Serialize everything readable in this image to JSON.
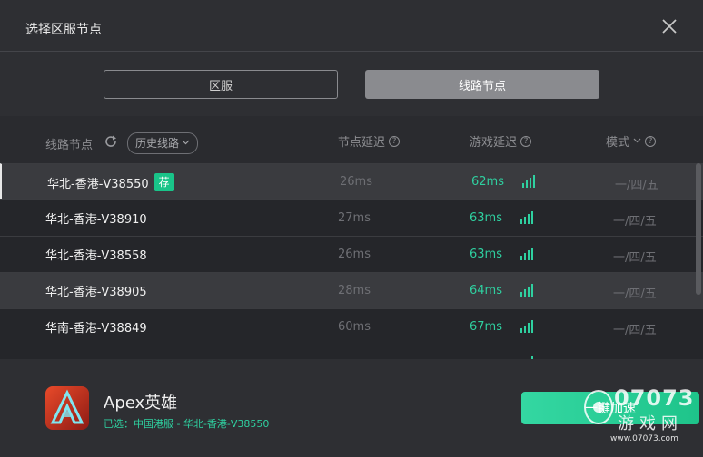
{
  "dialog": {
    "title": "选择区服节点",
    "close_icon": "close-icon"
  },
  "tabs": [
    {
      "label": "区服",
      "active": false
    },
    {
      "label": "线路节点",
      "active": true
    }
  ],
  "table": {
    "headers": {
      "route": "线路节点",
      "history": "历史线路",
      "node_ping": "节点延迟",
      "game_ping": "游戏延迟",
      "mode": "模式"
    },
    "rows": [
      {
        "name": "华北-香港-V38550",
        "badge": "荐",
        "node_ping": "26ms",
        "game_ping": "62ms",
        "mode": "一/四/五",
        "style": "alt",
        "selected": true
      },
      {
        "name": "华北-香港-V38910",
        "badge": "",
        "node_ping": "27ms",
        "game_ping": "63ms",
        "mode": "一/四/五",
        "style": "dark",
        "selected": false
      },
      {
        "name": "华北-香港-V38558",
        "badge": "",
        "node_ping": "26ms",
        "game_ping": "63ms",
        "mode": "一/四/五",
        "style": "dark",
        "selected": false
      },
      {
        "name": "华北-香港-V38905",
        "badge": "",
        "node_ping": "28ms",
        "game_ping": "64ms",
        "mode": "一/四/五",
        "style": "alt",
        "selected": false
      },
      {
        "name": "华南-香港-V38849",
        "badge": "",
        "node_ping": "60ms",
        "game_ping": "67ms",
        "mode": "一/四/五",
        "style": "dark",
        "selected": false
      },
      {
        "name": "",
        "badge": "",
        "node_ping": "",
        "game_ping": "",
        "mode": "",
        "style": "dark",
        "selected": false
      }
    ],
    "signal_color": "#2fd0a0"
  },
  "footer": {
    "game_name": "Apex英雄",
    "selected_info": "已选：中国港服 - 华北-香港-V38550",
    "accelerate_label": "一键加速"
  },
  "watermark": {
    "number": "07073",
    "chinese": "游戏网",
    "url": "www.07073.com"
  },
  "colors": {
    "accent": "#1ec48a",
    "text_green": "#2fd0a0",
    "background": "#2e2f33"
  }
}
